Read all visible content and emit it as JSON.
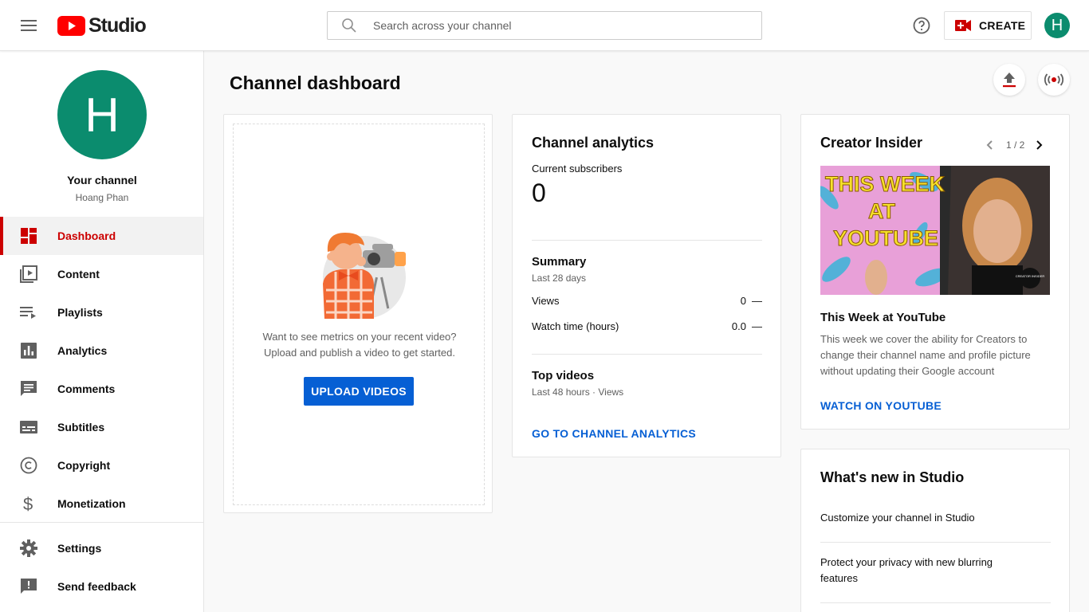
{
  "header": {
    "logo_text": "Studio",
    "search_placeholder": "Search across your channel",
    "create_label": "CREATE",
    "avatar_letter": "H",
    "brand_color": "#ff0000",
    "avatar_color": "#0b8c6e"
  },
  "sidebar": {
    "avatar_letter": "H",
    "your_channel": "Your channel",
    "channel_name": "Hoang Phan",
    "items": [
      {
        "label": "Dashboard",
        "icon": "dashboard-icon",
        "active": true
      },
      {
        "label": "Content",
        "icon": "content-icon"
      },
      {
        "label": "Playlists",
        "icon": "playlists-icon"
      },
      {
        "label": "Analytics",
        "icon": "analytics-icon"
      },
      {
        "label": "Comments",
        "icon": "comments-icon"
      },
      {
        "label": "Subtitles",
        "icon": "subtitles-icon"
      },
      {
        "label": "Copyright",
        "icon": "copyright-icon"
      },
      {
        "label": "Monetization",
        "icon": "monetization-icon"
      }
    ],
    "bottom_items": [
      {
        "label": "Settings",
        "icon": "gear-icon"
      },
      {
        "label": "Send feedback",
        "icon": "feedback-icon"
      }
    ],
    "active_color": "#cc0000"
  },
  "main": {
    "title": "Channel dashboard"
  },
  "upload_card": {
    "text_line1": "Want to see metrics on your recent video?",
    "text_line2": "Upload and publish a video to get started.",
    "button_label": "UPLOAD VIDEOS",
    "button_color": "#065fd4"
  },
  "analytics_card": {
    "title": "Channel analytics",
    "subscribers_label": "Current subscribers",
    "subscribers_value": "0",
    "summary_title": "Summary",
    "summary_period": "Last 28 days",
    "rows": [
      {
        "label": "Views",
        "value": "0",
        "delta": "—"
      },
      {
        "label": "Watch time (hours)",
        "value": "0.0",
        "delta": "—"
      }
    ],
    "top_videos_title": "Top videos",
    "top_videos_period": "Last 48 hours · Views",
    "link": "GO TO CHANNEL ANALYTICS"
  },
  "insider_card": {
    "title": "Creator Insider",
    "pager": "1 / 2",
    "thumb_text": [
      "THIS WEEK",
      "AT",
      "YOUTUBE"
    ],
    "thumb_badge": "CREATOR INSIDER",
    "video_title": "This Week at YouTube",
    "description": "This week we cover the ability for Creators to change their channel name and profile picture without updating their Google account",
    "link": "WATCH ON YOUTUBE"
  },
  "whats_new_card": {
    "title": "What's new in Studio",
    "items": [
      "Customize your channel in Studio",
      "Protect your privacy with new blurring features"
    ]
  }
}
